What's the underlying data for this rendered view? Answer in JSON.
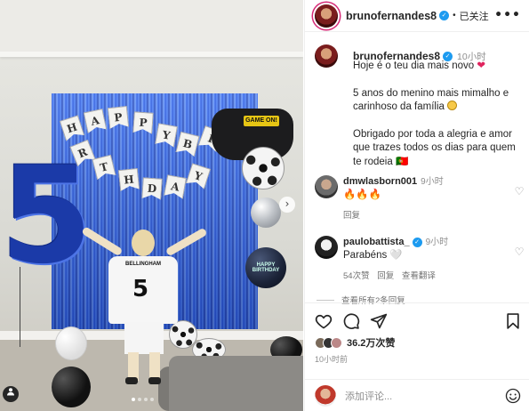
{
  "post": {
    "photo_badges": {
      "controller_label": "GAME ON!",
      "jersey_name": "BELLINGHAM",
      "jersey_number": "5",
      "balloon_number": "5",
      "banner_letters": [
        "H",
        "A",
        "P",
        "P",
        "Y",
        "B",
        "I",
        "R",
        "T",
        "H",
        "D",
        "A",
        "Y"
      ],
      "balloon_text": "HAPPY BIRTHDAY"
    },
    "carousel": {
      "next_icon": "›",
      "dot_count": 4,
      "active_dot": 0
    }
  },
  "header": {
    "username": "brunofernandes8",
    "separator": "•",
    "follow_state": "已关注",
    "more_icon": "•••"
  },
  "caption": {
    "username": "brunofernandes8",
    "time": "10小时",
    "line1": "Hoje é o teu dia mais novo",
    "line2": "5 anos do menino mais mimalho e carinhoso da família",
    "line3": "Obrigado por toda a alegria e amor que trazes todos os dias para quem te rodeia",
    "line3_suffix": "🇵🇹"
  },
  "comments": [
    {
      "username": "dmwlasborn001",
      "time": "9小时",
      "text": "🔥🔥🔥",
      "actions": [
        "回复"
      ]
    },
    {
      "username": "paulobattista_",
      "time": "9小时",
      "text": "Parabéns 🤍",
      "actions": [
        "54次赞",
        "回复",
        "查看翻译"
      ]
    }
  ],
  "view_replies": "查看所有2条回复",
  "footer": {
    "likes": "36.2万次赞",
    "post_time": "10小时前",
    "add_comment_placeholder": "添加评论..."
  },
  "colors": {
    "accent_blue": "#1d9bf0",
    "curtain_blue": "#2f6bff",
    "muted_text": "#8e8e8e"
  }
}
